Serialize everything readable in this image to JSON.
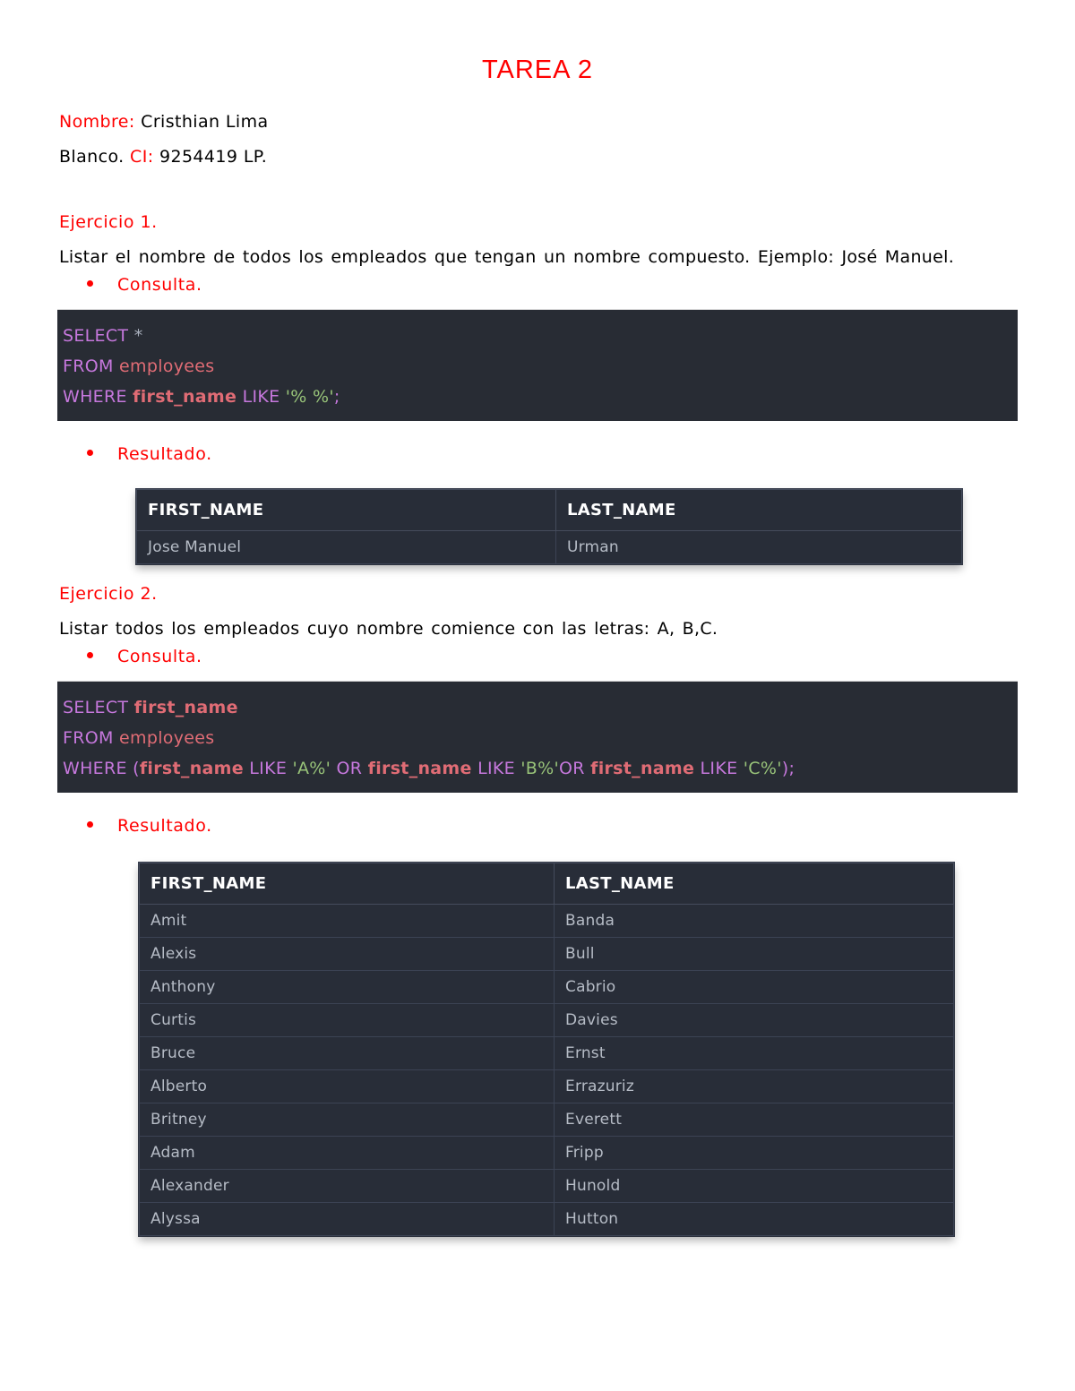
{
  "document": {
    "title": "TAREA 2",
    "title_color": "#ff0000"
  },
  "identity": {
    "name_label": "Nombre:",
    "name_value": "Cristhian Lima",
    "surname_value": "Blanco.",
    "ci_label": "CI:",
    "ci_value": "9254419 LP."
  },
  "exercise1": {
    "heading": "Ejercicio 1.",
    "description": "Listar el nombre de todos los empleados que tengan un nombre compuesto. Ejemplo: José Manuel.",
    "consulta_label": "Consulta.",
    "resultado_label": "Resultado.",
    "code": {
      "line1_kw": "SELECT",
      "line1_star": "*",
      "line2_kw": "FROM",
      "line2_tbl": "employees",
      "line3_kw": "WHERE",
      "line3_col": "first_name",
      "line3_op": "LIKE",
      "line3_str": "'% %'",
      "line3_end": ";"
    },
    "table": {
      "columns": [
        "FIRST_NAME",
        "LAST_NAME"
      ],
      "rows": [
        [
          "Jose Manuel",
          "Urman"
        ]
      ]
    }
  },
  "exercise2": {
    "heading": "Ejercicio 2.",
    "description": "Listar todos los empleados cuyo nombre comience con las letras: A, B,C.",
    "consulta_label": "Consulta.",
    "resultado_label": "Resultado.",
    "code": {
      "line1_kw": "SELECT",
      "line1_col": "first_name",
      "line2_kw": "FROM",
      "line2_tbl": "employees",
      "line3_kw": "WHERE",
      "line3_paren_open": "(",
      "line3_col1": "first_name",
      "line3_op1": "LIKE",
      "line3_str1": "'A%'",
      "line3_or1": "OR",
      "line3_col2": "first_name",
      "line3_op2": "LIKE",
      "line3_str2": "'B%'",
      "line3_or2": "OR",
      "line3_col3": "first_name",
      "line3_op3": "LIKE",
      "line3_str3": "'C%'",
      "line3_paren_close": ")",
      "line3_end": ";"
    },
    "table": {
      "columns": [
        "FIRST_NAME",
        "LAST_NAME"
      ],
      "rows": [
        [
          "Amit",
          "Banda"
        ],
        [
          "Alexis",
          "Bull"
        ],
        [
          "Anthony",
          "Cabrio"
        ],
        [
          "Curtis",
          "Davies"
        ],
        [
          "Bruce",
          "Ernst"
        ],
        [
          "Alberto",
          "Errazuriz"
        ],
        [
          "Britney",
          "Everett"
        ],
        [
          "Adam",
          "Fripp"
        ],
        [
          "Alexander",
          "Hunold"
        ],
        [
          "Alyssa",
          "Hutton"
        ]
      ]
    }
  },
  "theme": {
    "code_bg": "#282c34",
    "table_bg": "#282d38",
    "keyword_color": "#c678dd",
    "identifier_color": "#e06c75",
    "string_color": "#98c379",
    "accent_red": "#ff0000"
  }
}
